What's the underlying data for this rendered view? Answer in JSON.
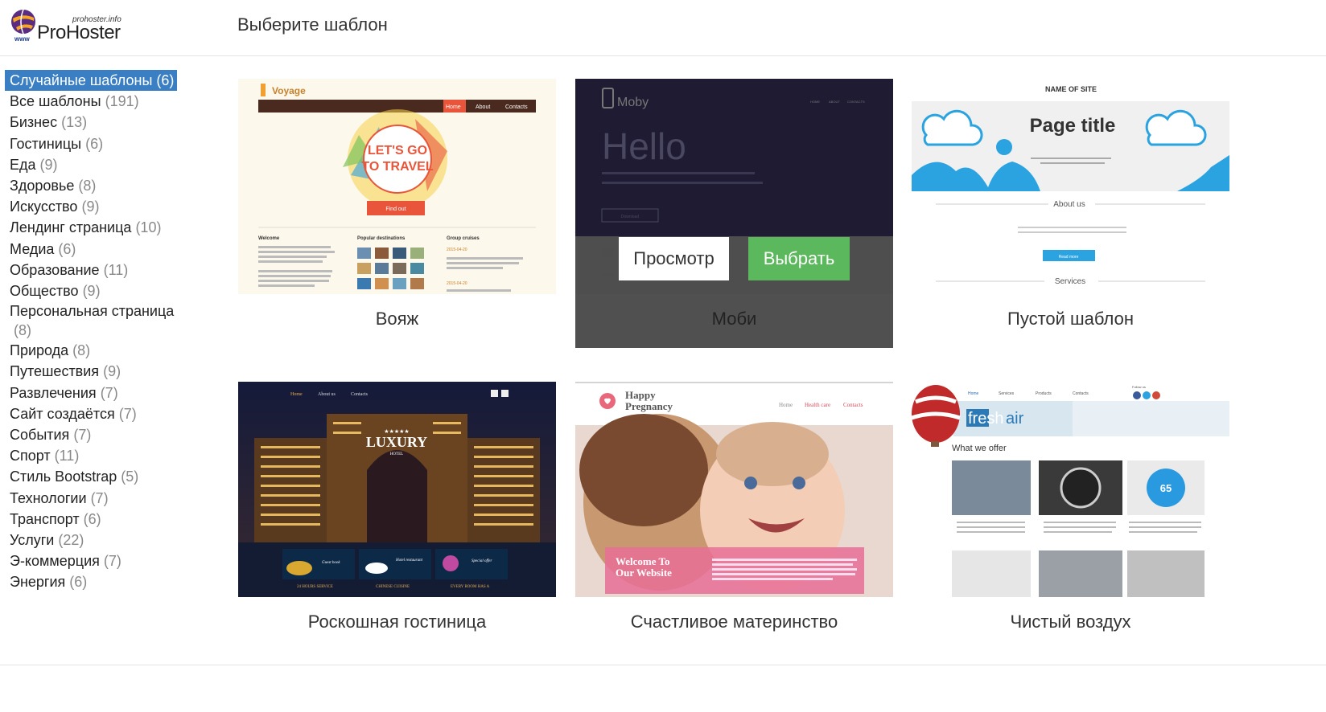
{
  "header": {
    "logo_domain": "prohoster.info",
    "logo_name": "ProHoster",
    "logo_www": "www",
    "page_title": "Выберите шаблон"
  },
  "sidebar": {
    "items": [
      {
        "label": "Случайные шаблоны",
        "count": "(6)",
        "active": true
      },
      {
        "label": "Все шаблоны",
        "count": "(191)"
      },
      {
        "label": "Бизнес",
        "count": "(13)"
      },
      {
        "label": "Гостиницы",
        "count": "(6)"
      },
      {
        "label": "Еда",
        "count": "(9)"
      },
      {
        "label": "Здоровье",
        "count": "(8)"
      },
      {
        "label": "Искусство",
        "count": "(9)"
      },
      {
        "label": "Лендинг страница",
        "count": "(10)"
      },
      {
        "label": "Медиа",
        "count": "(6)"
      },
      {
        "label": "Образование",
        "count": "(11)"
      },
      {
        "label": "Общество",
        "count": "(9)"
      },
      {
        "label": "Персональная страница",
        "count": "(8)",
        "wrap": true
      },
      {
        "label": "Природа",
        "count": "(8)"
      },
      {
        "label": "Путешествия",
        "count": "(9)"
      },
      {
        "label": "Развлечения",
        "count": "(7)"
      },
      {
        "label": "Сайт создаётся",
        "count": "(7)"
      },
      {
        "label": "События",
        "count": "(7)"
      },
      {
        "label": "Спорт",
        "count": "(11)"
      },
      {
        "label": "Стиль Bootstrap",
        "count": "(5)"
      },
      {
        "label": "Технологии",
        "count": "(7)"
      },
      {
        "label": "Транспорт",
        "count": "(6)"
      },
      {
        "label": "Услуги",
        "count": "(22)"
      },
      {
        "label": "Э-коммерция",
        "count": "(7)"
      },
      {
        "label": "Энергия",
        "count": "(6)"
      }
    ]
  },
  "templates": [
    {
      "title": "Вояж",
      "thumb": {
        "brand": "Voyage",
        "nav": [
          "Home",
          "About",
          "Contacts"
        ],
        "headline1": "LET'S GO",
        "headline2": "TO TRAVEL",
        "button": "Find out",
        "col1": "Welcome",
        "col2": "Popular destinations",
        "col3": "Group cruises",
        "date1": "2015-04-20",
        "date2": "2015-04-20"
      }
    },
    {
      "title": "Моби",
      "hover": true,
      "thumb": {
        "brand": "Moby",
        "nav": [
          "HOME",
          "ABOUT",
          "CONTACTS"
        ],
        "headline": "Hello",
        "text": "Please insert information that will be useful to your customers here Please insert information that will be...",
        "button": "Download"
      },
      "preview_label": "Просмотр",
      "select_label": "Выбрать"
    },
    {
      "title": "Пустой шаблон",
      "thumb": {
        "site_name": "NAME OF SITE",
        "page_title": "Page title",
        "about": "About us",
        "button": "Read more",
        "services": "Services"
      }
    },
    {
      "title": "Роскошная гостиница",
      "thumb": {
        "nav": [
          "Home",
          "About us",
          "Contacts"
        ],
        "stars": "★★★★★",
        "headline": "LUXURY",
        "sub": "HOTEL",
        "panels": [
          "Guest book",
          "Hotel restaurant",
          "Special offer"
        ],
        "captions": [
          "24 HOURS SERVICE",
          "CHINESE CUISINE",
          "EVERY ROOM HAS A"
        ]
      }
    },
    {
      "title": "Счастливое материнство",
      "thumb": {
        "brand1": "Happy",
        "brand2": "Pregnancy",
        "nav": [
          "Home",
          "Health care",
          "Contacts"
        ],
        "welcome1": "Welcome To",
        "welcome2": "Our Website"
      }
    },
    {
      "title": "Чистый воздух",
      "thumb": {
        "nav": [
          "Home",
          "Services",
          "Products",
          "Contacts"
        ],
        "follow": "Follow us",
        "logo1": "fresh",
        "logo2": "air",
        "offer": "What we offer",
        "gauge": "65"
      }
    }
  ],
  "colors": {
    "active_bg": "#3a7fc4",
    "select_btn": "#5cb85c"
  }
}
